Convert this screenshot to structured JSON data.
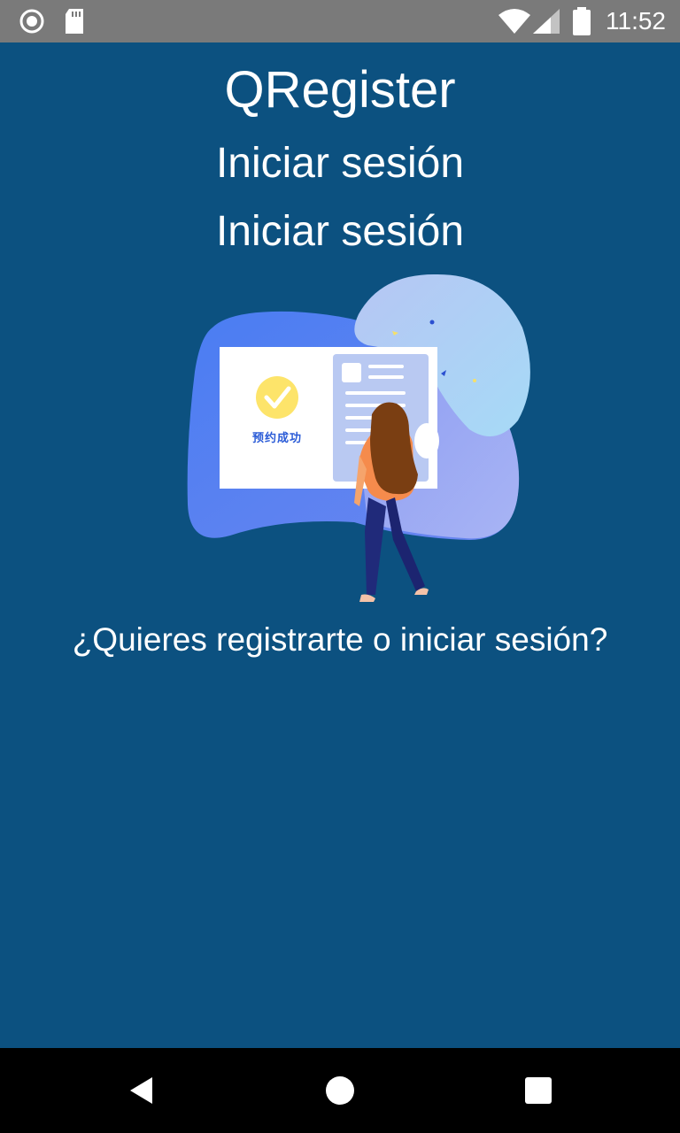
{
  "status_bar": {
    "time": "11:52",
    "left_icons": [
      "record-icon",
      "sd-card-icon"
    ],
    "right_icons": [
      "wifi-icon",
      "signal-icon",
      "battery-icon"
    ]
  },
  "app": {
    "title": "QRegister",
    "subtitle_primary": "Iniciar sesión",
    "subtitle_secondary": "Iniciar sesión",
    "question": "¿Quieres registrarte o iniciar sesión?"
  },
  "illustration": {
    "card_text": "预约成功",
    "icons": [
      "check-icon"
    ]
  },
  "nav_bar": {
    "buttons": [
      "back-icon",
      "home-icon",
      "recents-icon"
    ]
  },
  "colors": {
    "background": "#0c5180",
    "status_bar": "#7a7a7a",
    "nav_bar": "#000000",
    "text": "#ffffff",
    "check_yellow": "#fde46a",
    "card_text_blue": "#2a5bd7"
  }
}
